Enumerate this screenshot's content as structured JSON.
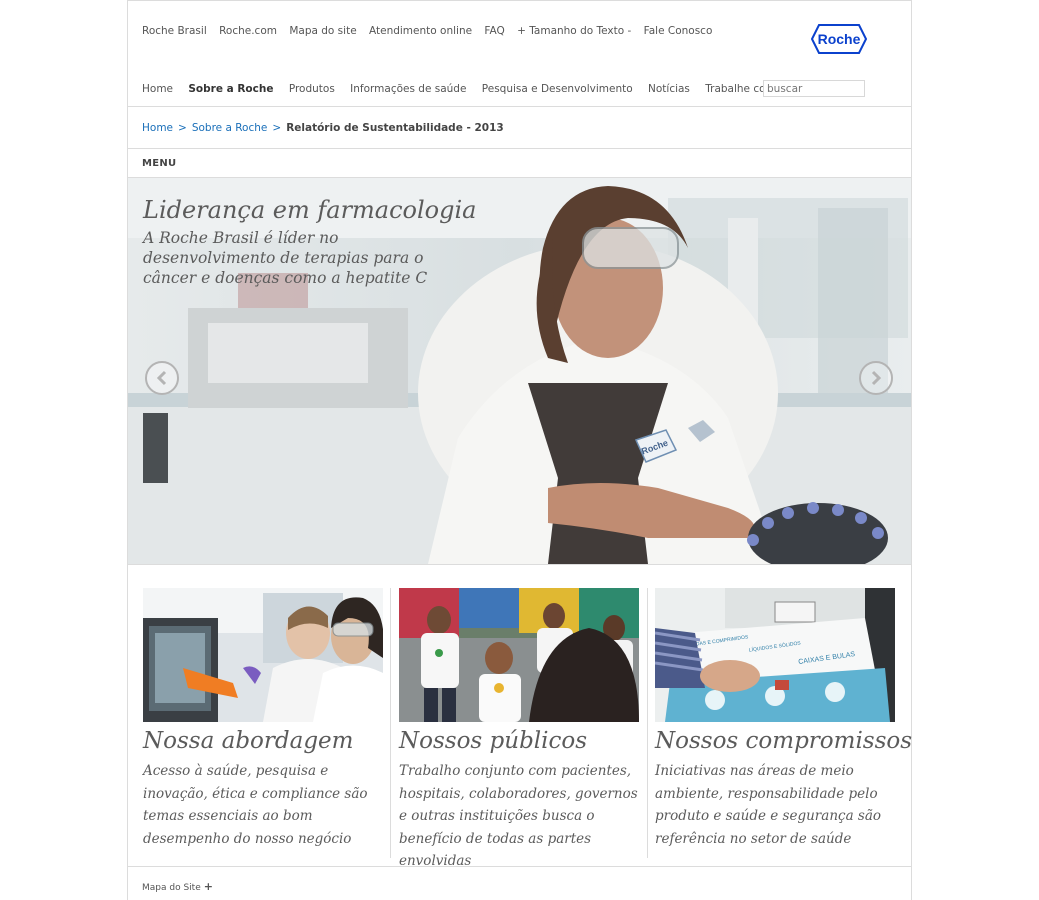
{
  "top_links": [
    "Roche Brasil",
    "Roche.com",
    "Mapa do site",
    "Atendimento online",
    "FAQ",
    "+ Tamanho do Texto -",
    "Fale Conosco"
  ],
  "logo_text": "Roche",
  "nav": {
    "items": [
      "Home",
      "Sobre a Roche",
      "Produtos",
      "Informações de saúde",
      "Pesquisa e Desenvolvimento",
      "Notícias",
      "Trabalhe conosco"
    ],
    "active": "Sobre a Roche"
  },
  "search": {
    "placeholder": "buscar"
  },
  "breadcrumb": {
    "home": "Home",
    "parent": "Sobre a Roche",
    "current": "Relatório de Sustentabilidade - 2013",
    "separator": ">"
  },
  "menu_label": "MENU",
  "hero": {
    "title": "Liderança em farmacologia",
    "subtitle": "A Roche Brasil é líder no desenvolvimento de terapias para o câncer e doenças como a hepatite C",
    "badge_text": "Roche"
  },
  "cards": [
    {
      "title": "Nossa abordagem",
      "text": "Acesso à saúde, pesquisa e inovação, ética e compliance são temas essenciais ao bom desempenho do nosso negócio"
    },
    {
      "title": "Nossos públicos",
      "text": "Trabalho conjunto com pacientes, hospitais, colaboradores, governos e outras instituições busca o benefício de todas as partes envolvidas"
    },
    {
      "title": "Nossos compromissos",
      "text": "Iniciativas nas áreas de meio ambiente, responsabilidade pelo produto e saúde e segurança são referência no setor de saúde"
    }
  ],
  "card3_bin_labels": [
    "CAIXAS E BULAS",
    "LÍQUIDOS E SÓLIDOS",
    "POMADAS E COMPRIMIDOS"
  ],
  "footer": {
    "label": "Mapa do Site",
    "icon": "+"
  },
  "colors": {
    "link_blue": "#1a6fb9",
    "logo_blue": "#0b41cd",
    "text_gray": "#5b5b5b",
    "border": "#dcdcdc"
  }
}
